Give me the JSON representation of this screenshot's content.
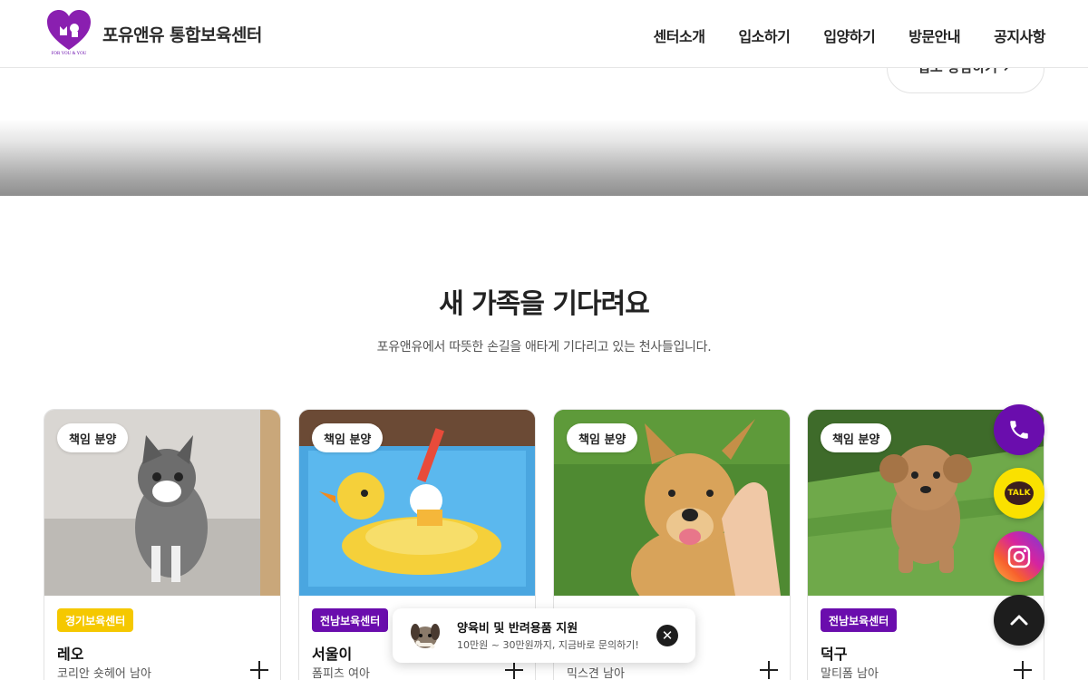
{
  "header": {
    "brand": "포유앤유 통합보육센터",
    "logo_text": "FOR YOU & YOU",
    "nav": [
      "센터소개",
      "입소하기",
      "입양하기",
      "방문안내",
      "공지사항"
    ]
  },
  "hero": {
    "button_label": "입소 상담하기 ↗"
  },
  "section": {
    "title": "새 가족을 기다려요",
    "subtitle": "포유앤유에서 따뜻한 손길을 애타게 기다리고 있는 천사들입니다."
  },
  "cards": [
    {
      "pill": "책임 분양",
      "badge": "경기보육센터",
      "badge_color": "#f5c800",
      "name": "레오",
      "desc": "코리안 숏헤어 남아"
    },
    {
      "pill": "책임 분양",
      "badge": "전남보육센터",
      "badge_color": "#6a0dad",
      "name": "서울이",
      "desc": "폼피츠 여아"
    },
    {
      "pill": "책임 분양",
      "badge": "",
      "badge_color": "#6a0dad",
      "name": "",
      "desc": "믹스견 남아"
    },
    {
      "pill": "책임 분양",
      "badge": "전남보육센터",
      "badge_color": "#6a0dad",
      "name": "덕구",
      "desc": "말티폼 남아"
    }
  ],
  "floating": {
    "talk_label": "TALK"
  },
  "toast": {
    "title": "양육비 및 반려용품 지원",
    "subtitle": "10만원 ~ 30만원까지, 지금바로 문의하기!",
    "close": "✕"
  },
  "colors": {
    "brand_purple": "#6a0dad",
    "kakao_yellow": "#fae100",
    "badge_yellow": "#f5c800"
  }
}
